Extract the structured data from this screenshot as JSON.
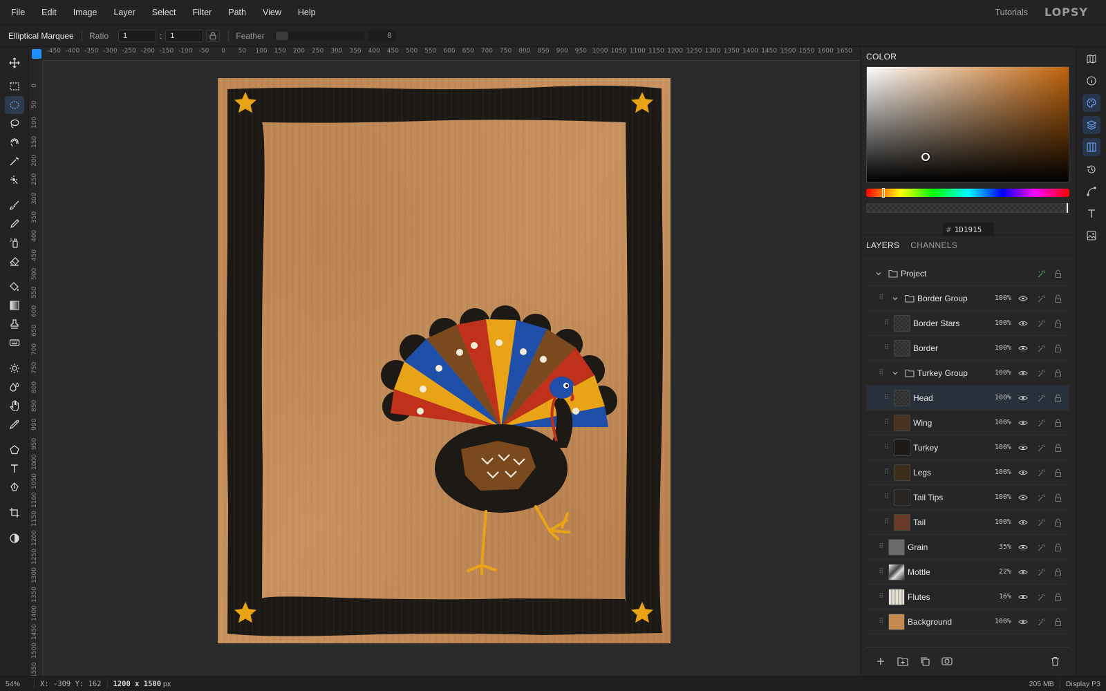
{
  "menu": {
    "items": [
      "File",
      "Edit",
      "Image",
      "Layer",
      "Select",
      "Filter",
      "Path",
      "View",
      "Help"
    ],
    "tutorials": "Tutorials",
    "brand": "LOPSY"
  },
  "options": {
    "tool_name": "Elliptical Marquee",
    "ratio_label": "Ratio",
    "ratio_w": "1",
    "ratio_colon": ":",
    "ratio_h": "1",
    "feather_label": "Feather",
    "feather_value": "0"
  },
  "tools": [
    "move-tool",
    "rectangular-marquee-tool",
    "elliptical-marquee-tool",
    "lasso-tool",
    "magnetic-lasso-tool",
    "magic-wand-tool",
    "quick-selection-tool",
    "brush-tool",
    "pencil-tool",
    "spray-tool",
    "eraser-tool",
    "paint-bucket-tool",
    "gradient-tool",
    "clone-stamp-tool",
    "pattern-stamp-tool",
    "dodge-tool",
    "blur-tool",
    "smudge-tool",
    "eyedropper-tool",
    "polygon-tool",
    "text-tool",
    "pen-tool",
    "crop-tool",
    "adjustments-tool"
  ],
  "ruler": {
    "top_ticks": [
      "-450",
      "-400",
      "-350",
      "-300",
      "-250",
      "-200",
      "-150",
      "-100",
      "-50",
      "0",
      "50",
      "100",
      "150",
      "200",
      "250",
      "300",
      "350",
      "400",
      "450",
      "500",
      "550",
      "600",
      "650",
      "700",
      "750",
      "800",
      "850",
      "900",
      "950",
      "1000",
      "1050",
      "1100",
      "1150",
      "1200",
      "1250",
      "1300",
      "1350",
      "1400",
      "1450",
      "1500",
      "1550",
      "1600",
      "1650"
    ],
    "left_ticks": [
      "0",
      "50",
      "100",
      "150",
      "200",
      "250",
      "300",
      "350",
      "400",
      "450",
      "500",
      "550",
      "600",
      "650",
      "700",
      "750",
      "800",
      "850",
      "900",
      "950",
      "1000",
      "1050",
      "1100",
      "1150",
      "1200",
      "1250",
      "1300",
      "1350",
      "1400",
      "1450",
      "1500",
      "1550"
    ]
  },
  "color_panel": {
    "tab": "COLOR",
    "hex_prefix": "#",
    "hex": "1D1915",
    "base_hue": "#c0640c"
  },
  "layers_panel": {
    "tabs": [
      "LAYERS",
      "CHANNELS"
    ],
    "layers": [
      {
        "name": "Project",
        "opacity": "",
        "type": "project"
      },
      {
        "name": "Border Group",
        "opacity": "100%",
        "type": "group"
      },
      {
        "name": "Border Stars",
        "opacity": "100%",
        "type": "child"
      },
      {
        "name": "Border",
        "opacity": "100%",
        "type": "child"
      },
      {
        "name": "Turkey Group",
        "opacity": "100%",
        "type": "group"
      },
      {
        "name": "Head",
        "opacity": "100%",
        "type": "child",
        "selected": true
      },
      {
        "name": "Wing",
        "opacity": "100%",
        "type": "child"
      },
      {
        "name": "Turkey",
        "opacity": "100%",
        "type": "child"
      },
      {
        "name": "Legs",
        "opacity": "100%",
        "type": "child"
      },
      {
        "name": "Tail Tips",
        "opacity": "100%",
        "type": "child"
      },
      {
        "name": "Tail",
        "opacity": "100%",
        "type": "child"
      },
      {
        "name": "Grain",
        "opacity": "35%",
        "type": "top"
      },
      {
        "name": "Mottle",
        "opacity": "22%",
        "type": "top"
      },
      {
        "name": "Flutes",
        "opacity": "16%",
        "type": "top"
      },
      {
        "name": "Background",
        "opacity": "100%",
        "type": "top"
      }
    ]
  },
  "status": {
    "zoom": "54%",
    "coords": "X: -309 Y: 162",
    "doc_size_value": "1200 x 1500",
    "doc_size_unit": "px",
    "memory": "205 MB",
    "color_profile": "Display P3"
  },
  "colors": {
    "accent": "#1e90ff",
    "paper": "#c48a52",
    "border": "#1d1915",
    "star": "#e8a317",
    "turkey_red": "#c0311b",
    "turkey_blue": "#1f4fa8",
    "turkey_brown": "#7a4a1e"
  }
}
